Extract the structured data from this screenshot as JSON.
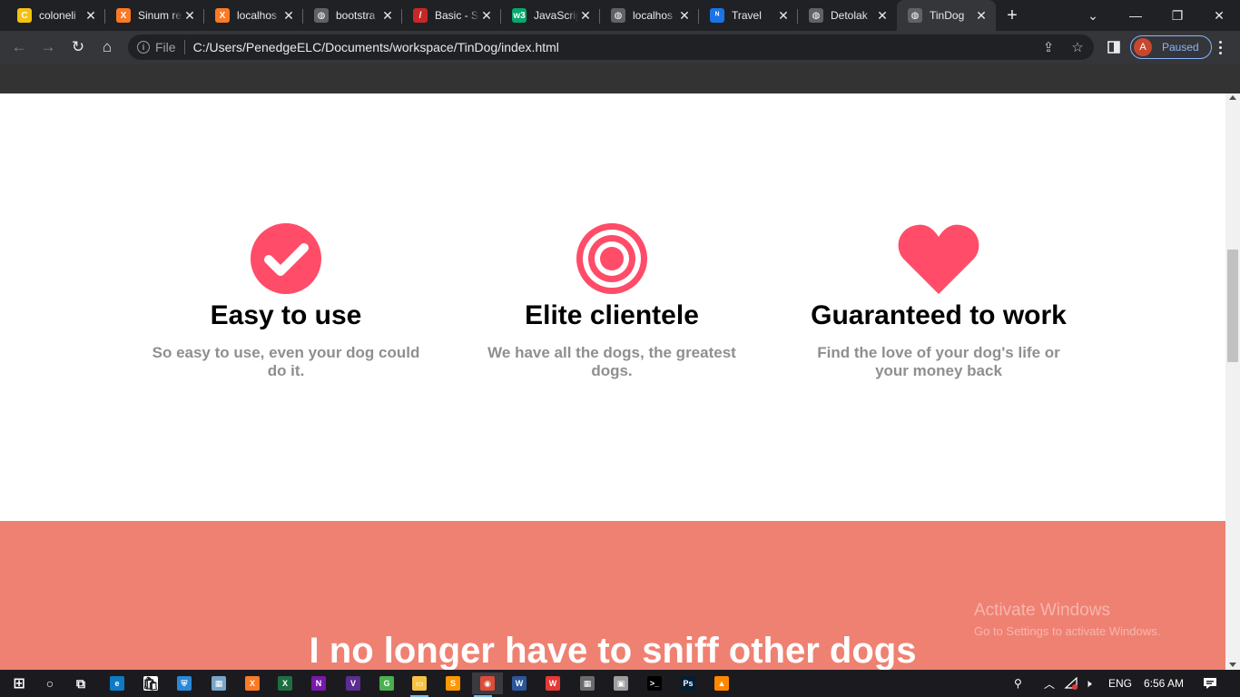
{
  "browser": {
    "tabs": [
      {
        "title": "coloneli",
        "favicon": "colonel-icon",
        "color": "#f4c20d",
        "glyph": "C"
      },
      {
        "title": "Sinum re",
        "favicon": "xampp-icon",
        "color": "#fb7a24",
        "glyph": "X"
      },
      {
        "title": "localhos",
        "favicon": "xampp-icon",
        "color": "#fb7a24",
        "glyph": "X"
      },
      {
        "title": "bootstra",
        "favicon": "globe-icon",
        "color": "#5f6368",
        "glyph": "◍"
      },
      {
        "title": "Basic - S",
        "favicon": "basic-icon",
        "color": "#c62828",
        "glyph": "/"
      },
      {
        "title": "JavaScrip",
        "favicon": "w3schools-icon",
        "color": "#04aa6d",
        "glyph": "w3"
      },
      {
        "title": "localhos",
        "favicon": "globe-icon",
        "color": "#5f6368",
        "glyph": "◍"
      },
      {
        "title": "Travel",
        "favicon": "travel-icon",
        "color": "#1a73e8",
        "glyph": "ᴺ"
      },
      {
        "title": "Detolak",
        "favicon": "globe-icon",
        "color": "#5f6368",
        "glyph": "◍"
      },
      {
        "title": "TinDog",
        "favicon": "globe-icon",
        "color": "#5f6368",
        "glyph": "◍",
        "active": true
      }
    ],
    "new_tab": "+",
    "address": {
      "scheme_label": "File",
      "url": "C:/Users/PenedgeELC/Documents/workspace/TinDog/index.html"
    },
    "profile": {
      "initial": "A",
      "status": "Paused"
    }
  },
  "page": {
    "features": [
      {
        "icon": "check-circle-icon",
        "title": "Easy to use",
        "text": "So easy to use, even your dog could do it."
      },
      {
        "icon": "bullseye-icon",
        "title": "Elite clientele",
        "text": "We have all the dogs, the greatest dogs."
      },
      {
        "icon": "heart-icon",
        "title": "Guaranteed to work",
        "text": "Find the love of your dog's life or your money back"
      }
    ],
    "accent_color": "#ff4c68",
    "testimonial_bg": "#ef8172",
    "testimonial_quote": "I no longer have to sniff other dogs",
    "watermark": {
      "line1": "Activate Windows",
      "line2": "Go to Settings to activate Windows."
    }
  },
  "taskbar": {
    "apps": [
      "windows-start-icon",
      "search-icon",
      "task-view-icon",
      "edge-icon",
      "store-icon",
      "defender-icon",
      "photos-icon",
      "xampp-icon",
      "excel-icon",
      "onenote-icon",
      "vs-icon",
      "greenshot-icon",
      "file-explorer-icon",
      "sublime-icon",
      "chrome-icon",
      "word-icon",
      "wps-icon",
      "calculator-icon",
      "reader-icon",
      "cmd-icon",
      "photoshop-icon",
      "vlc-icon"
    ],
    "language": "ENG",
    "time": "6:56 AM"
  }
}
